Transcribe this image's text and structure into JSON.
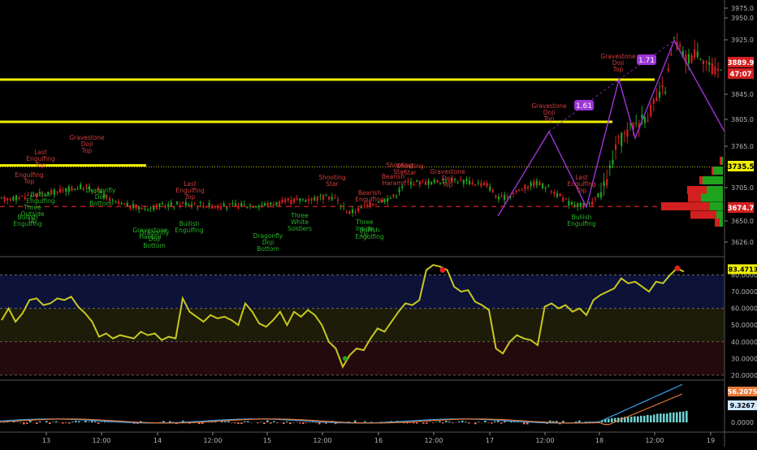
{
  "colors": {
    "background": "#000000",
    "bull": "#1fa31f",
    "bear": "#d22020",
    "level_line": "#f0f000",
    "pattern": "#9d35d8",
    "stoch": "#c8c820",
    "bull_label": "#28b428",
    "bear_label": "#d23c3c",
    "axis_text": "#b4b4b4"
  },
  "x_axis": {
    "ticks": [
      "13",
      "12:00",
      "14",
      "12:00",
      "15",
      "12:00",
      "16",
      "12:00",
      "17",
      "12:00",
      "18",
      "12:00",
      "19"
    ]
  },
  "price_axis": {
    "ticks": [
      "3975.0",
      "3950.0",
      "3925.0",
      "3845.0",
      "3805.0",
      "3765.0",
      "3705.0",
      "3650.0",
      "3626.0"
    ],
    "badges": [
      {
        "text": "3889.9",
        "color": "#d22020",
        "text_color": "#ffffff"
      },
      {
        "text": "47:07",
        "color": "#d22020",
        "text_color": "#ffffff"
      },
      {
        "text": "3735.5",
        "color": "#f0f000",
        "text_color": "#000000"
      },
      {
        "text": "3674.7",
        "color": "#d22020",
        "text_color": "#ffffff"
      }
    ]
  },
  "harmonic_labels": [
    {
      "text": "1.61",
      "color": "#9d35d8"
    },
    {
      "text": "1.71",
      "color": "#9d35d8"
    }
  ],
  "pattern_annotations": {
    "bear": [
      [
        "Last",
        "Engulfing",
        "Top"
      ],
      [
        "Engulfing",
        "Top"
      ],
      [
        "Gravestone",
        "Doji",
        "Top"
      ],
      [
        "Last",
        "Engulfing",
        "Top"
      ],
      [
        "Shooting",
        "Star"
      ],
      [
        "Bearish",
        "Engulfing"
      ],
      [
        "Gravestone",
        "Doji",
        "Top"
      ],
      [
        "Shooting",
        "Star"
      ],
      [
        "Bearish",
        "Harami"
      ],
      [
        "Shooting",
        "Star"
      ],
      [
        "Gravestone",
        "Doji",
        "Top"
      ],
      [
        "Last",
        "Engulfing",
        "Top"
      ],
      [
        "Gravestone",
        "Doji",
        "Top"
      ]
    ],
    "bull": [
      [
        "Bullish",
        "Engulfing"
      ],
      [
        "Three",
        "Outside",
        "Up"
      ],
      [
        "Bullish",
        "Engulfing"
      ],
      [
        "Dragonfly",
        "Doji",
        "Bottom"
      ],
      [
        "Gravestone",
        "Harami"
      ],
      [
        "Dragonfly",
        "Doji",
        "Bottom"
      ],
      [
        "Bullish",
        "Engulfing"
      ],
      [
        "Dragonfly",
        "Doji",
        "Bottom"
      ],
      [
        "Three",
        "White",
        "Soldiers"
      ],
      [
        "Three",
        "Inside",
        "Up"
      ],
      [
        "Bullish",
        "Engulfing"
      ],
      [
        "Bullish",
        "Engulfing"
      ]
    ]
  },
  "stoch_axis": {
    "ticks": [
      "80.0000",
      "70.0000",
      "60.0000",
      "50.0000",
      "40.0000",
      "30.0000",
      "20.0000"
    ],
    "badge": {
      "text": "83.4713",
      "color": "#f0f000",
      "text_color": "#000000"
    },
    "zones": [
      {
        "from": 70,
        "to": 80,
        "color": "#0c1238"
      },
      {
        "from": 60,
        "to": 70,
        "color": "#0c1238"
      },
      {
        "from": 40,
        "to": 60,
        "color": "#1c1c08"
      },
      {
        "from": 20,
        "to": 40,
        "color": "#240a0c"
      }
    ]
  },
  "macd_axis": {
    "ticks": [
      "0.0000"
    ],
    "badges": [
      {
        "text": "56.2075",
        "color": "#e87a3a",
        "text_color": "#ffffff"
      },
      {
        "text": "9.3267",
        "color": "#cfe8ff",
        "text_color": "#000000"
      }
    ]
  },
  "chart_data": [
    {
      "type": "candlestick",
      "title": "",
      "ylim": [
        3600,
        3985
      ],
      "horizontal_levels": [
        3870,
        3805,
        3738
      ],
      "dashed_level": 3674.7,
      "harmonic_path": {
        "x": [
          613,
          676,
          722,
          762,
          782,
          830,
          892
        ],
        "y": [
          3660,
          3790,
          3674,
          3870,
          3780,
          3930,
          3790
        ]
      },
      "volume_profile": [
        {
          "price": 3745,
          "buy": 2,
          "sell": 2
        },
        {
          "price": 3730,
          "buy": 12,
          "sell": 2
        },
        {
          "price": 3715,
          "buy": 25,
          "sell": 4
        },
        {
          "price": 3700,
          "buy": 20,
          "sell": 24
        },
        {
          "price": 3688,
          "buy": 27,
          "sell": 16
        },
        {
          "price": 3675,
          "buy": 16,
          "sell": 60
        },
        {
          "price": 3662,
          "buy": 8,
          "sell": 32
        },
        {
          "price": 3650,
          "buy": 4,
          "sell": 6
        }
      ]
    },
    {
      "type": "line",
      "title": "",
      "ylim": [
        18,
        90
      ],
      "series": [
        {
          "values": [
            53,
            60,
            52,
            57,
            65,
            66,
            62,
            63,
            66,
            65,
            67,
            61,
            57,
            52,
            43,
            45,
            42,
            44,
            43,
            42,
            46,
            44,
            45,
            41,
            43,
            42,
            66,
            58,
            55,
            52,
            56,
            54,
            55,
            53,
            50,
            63,
            58,
            51,
            49,
            53,
            58,
            50,
            58,
            55,
            59,
            56,
            50,
            40,
            36,
            25,
            32,
            36,
            35,
            42,
            48,
            46,
            52,
            58,
            63,
            62,
            65,
            83,
            86,
            85,
            83,
            73,
            70,
            71,
            64,
            62,
            59,
            36,
            33,
            40,
            44,
            42,
            41,
            38,
            61,
            63,
            60,
            62,
            58,
            60,
            56,
            65,
            68,
            70,
            72,
            78,
            75,
            76,
            73,
            70,
            76,
            75,
            80,
            84,
            82
          ]
        }
      ]
    },
    {
      "type": "histogram",
      "title": "",
      "ylim": [
        -12,
        60
      ]
    }
  ]
}
